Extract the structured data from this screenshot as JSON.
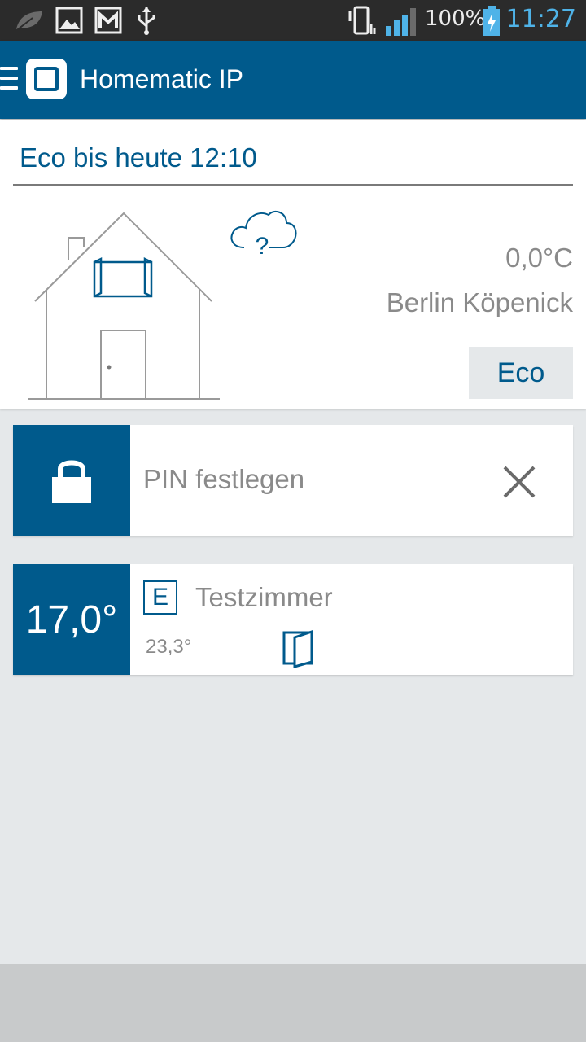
{
  "statusbar": {
    "battery": "100%",
    "time": "11:27",
    "icons": [
      "leaf-icon",
      "image-icon",
      "gmail-icon",
      "usb-icon",
      "vibrate-icon",
      "signal-icon",
      "battery-charging-icon"
    ]
  },
  "appbar": {
    "title": "Homematic IP",
    "color": "#005a8c"
  },
  "home": {
    "mode_text": "Eco bis heute 12:10",
    "outside_temp": "0,0°C",
    "location": "Berlin Köpenick",
    "eco_button": "Eco",
    "weather_symbol": "?"
  },
  "pin_card": {
    "label": "PIN festlegen"
  },
  "room_card": {
    "set_temp": "17,0°",
    "mode_badge": "E",
    "name": "Testzimmer",
    "actual_temp": "23,3°"
  },
  "colors": {
    "accent": "#005a8c",
    "background": "#e5e8ea",
    "text_grey": "#8a8a8a",
    "clock": "#4fb3e8"
  }
}
